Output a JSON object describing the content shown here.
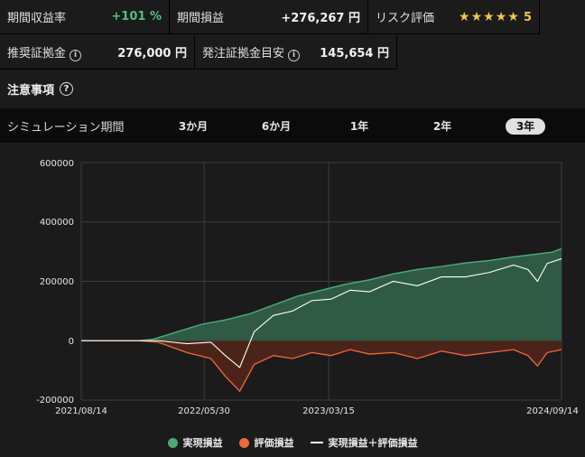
{
  "stats_row1": {
    "return_label": "期間収益率",
    "return_value": "+101 %",
    "pnl_label": "期間損益",
    "pnl_value": "+276,267 円",
    "risk_label": "リスク評価",
    "risk_stars": "★★★★★",
    "risk_value": "5"
  },
  "stats_row2": {
    "margin_label": "推奨証拠金",
    "margin_value": "276,000 円",
    "order_margin_label": "発注証拠金目安",
    "order_margin_value": "145,654 円"
  },
  "notes": {
    "label": "注意事項",
    "help_glyph": "?"
  },
  "info_glyph": "i",
  "simulation": {
    "label": "シミュレーション期間",
    "tabs": [
      "3か月",
      "6か月",
      "1年",
      "2年",
      "3年"
    ],
    "active_tab": "3年"
  },
  "legend": {
    "realized": "実現損益",
    "unrealized": "評価損益",
    "total": "実現損益＋評価損益"
  },
  "colors": {
    "realized": "#4aa874",
    "unrealized": "#ee6a3a",
    "total": "#ffffff",
    "positive": "#4ec27f",
    "star": "#f0c74a"
  },
  "chart_data": {
    "type": "area",
    "x_ticks": [
      "2021/08/14",
      "2022/05/30",
      "2023/03/15",
      "2024/09/14"
    ],
    "y_ticks": [
      "600000",
      "400000",
      "200000",
      "0",
      "-200000"
    ],
    "ylim": [
      -200000,
      600000
    ],
    "series": [
      {
        "name": "実現損益",
        "x": [
          0,
          0.12,
          0.15,
          0.2,
          0.25,
          0.3,
          0.35,
          0.4,
          0.45,
          0.5,
          0.55,
          0.6,
          0.65,
          0.7,
          0.75,
          0.8,
          0.85,
          0.9,
          0.95,
          0.98,
          1.0
        ],
        "values": [
          0,
          0,
          5000,
          30000,
          55000,
          70000,
          90000,
          120000,
          150000,
          170000,
          190000,
          205000,
          225000,
          240000,
          250000,
          262000,
          270000,
          282000,
          292000,
          298000,
          310000
        ]
      },
      {
        "name": "評価損益",
        "x": [
          0,
          0.12,
          0.16,
          0.22,
          0.27,
          0.3,
          0.33,
          0.36,
          0.4,
          0.44,
          0.48,
          0.52,
          0.56,
          0.6,
          0.65,
          0.7,
          0.75,
          0.8,
          0.85,
          0.9,
          0.93,
          0.95,
          0.97,
          1.0
        ],
        "values": [
          0,
          0,
          -5000,
          -40000,
          -60000,
          -120000,
          -170000,
          -80000,
          -50000,
          -60000,
          -40000,
          -50000,
          -30000,
          -45000,
          -40000,
          -60000,
          -35000,
          -50000,
          -40000,
          -30000,
          -50000,
          -85000,
          -40000,
          -30000
        ]
      },
      {
        "name": "実現損益＋評価損益",
        "x": [
          0,
          0.12,
          0.16,
          0.22,
          0.27,
          0.3,
          0.33,
          0.36,
          0.4,
          0.44,
          0.48,
          0.52,
          0.56,
          0.6,
          0.65,
          0.7,
          0.75,
          0.8,
          0.85,
          0.9,
          0.93,
          0.95,
          0.97,
          1.0
        ],
        "values": [
          0,
          0,
          0,
          -10000,
          -5000,
          -50000,
          -90000,
          30000,
          85000,
          100000,
          135000,
          140000,
          170000,
          165000,
          200000,
          185000,
          215000,
          215000,
          230000,
          255000,
          240000,
          200000,
          260000,
          276267
        ]
      }
    ],
    "grid": true
  }
}
